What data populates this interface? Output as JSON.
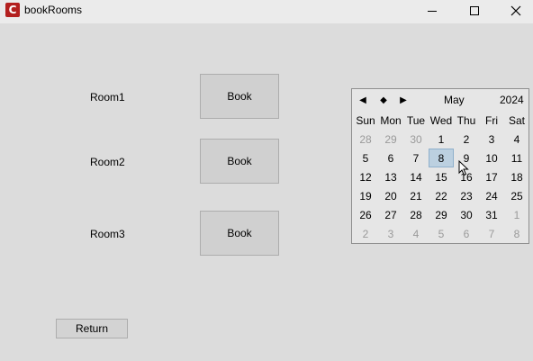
{
  "window": {
    "title": "bookRooms",
    "icon_letter": "C",
    "icon_color": "#b3201f",
    "controls": [
      "minimize-icon",
      "maximize-icon",
      "close-icon"
    ]
  },
  "rooms": [
    {
      "label": "Room1",
      "button": "Book"
    },
    {
      "label": "Room2",
      "button": "Book"
    },
    {
      "label": "Room3",
      "button": "Book"
    }
  ],
  "return_label": "Return",
  "calendar": {
    "nav": {
      "prev": "◀",
      "today": "◆",
      "next": "▶"
    },
    "month": "May",
    "year": "2024",
    "weekdays": [
      "Sun",
      "Mon",
      "Tue",
      "Wed",
      "Thu",
      "Fri",
      "Sat"
    ],
    "weeks": [
      [
        "28",
        "29",
        "30",
        "1",
        "2",
        "3",
        "4"
      ],
      [
        "5",
        "6",
        "7",
        "8",
        "9",
        "10",
        "11"
      ],
      [
        "12",
        "13",
        "14",
        "15",
        "16",
        "17",
        "18"
      ],
      [
        "19",
        "20",
        "21",
        "22",
        "23",
        "24",
        "25"
      ],
      [
        "26",
        "27",
        "28",
        "29",
        "30",
        "31",
        "1"
      ],
      [
        "2",
        "3",
        "4",
        "5",
        "6",
        "7",
        "8"
      ]
    ],
    "selected_day": "8",
    "selected_color": "#bcd0e0"
  }
}
